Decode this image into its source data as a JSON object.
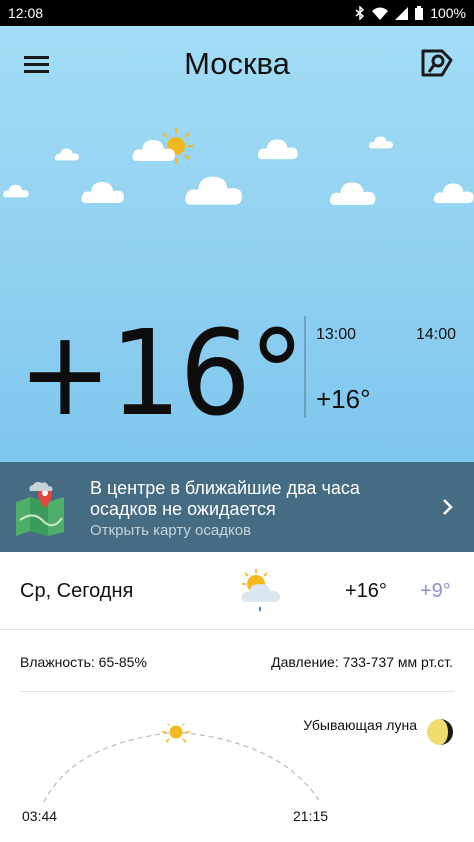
{
  "status_bar": {
    "time": "12:08",
    "battery": "100%"
  },
  "header": {
    "city": "Москва"
  },
  "current": {
    "temperature": "+16°"
  },
  "hourly": [
    {
      "time": "13:00",
      "temperature": ""
    },
    {
      "time": "14:00",
      "temperature": "+16°"
    }
  ],
  "nowcast": {
    "title": "В центре в ближайшие два часа осадков не ожидается",
    "link": "Открыть карту осадков"
  },
  "today": {
    "label": "Ср, Сегодня",
    "max": "+16°",
    "min": "+9°",
    "icon": "partly-cloudy-rain-icon"
  },
  "details": {
    "humidity": "Влажность: 65-85%",
    "pressure": "Давление: 733-737 мм рт.ст.",
    "sunrise": "03:44",
    "sunset": "21:15",
    "moon_phase": "Убывающая луна",
    "sun_position": 0.5
  },
  "icons": {
    "menu": "hamburger-menu-icon",
    "map": "map-pin-icon",
    "chevron": "chevron-right-icon",
    "moon": "waning-moon-icon"
  },
  "colors": {
    "sky_top": "#a3ddf6",
    "sky_bottom": "#7ec7ee",
    "banner": "#456c82",
    "min_temp": "#8a94c9",
    "sun": "#f5b81f"
  }
}
